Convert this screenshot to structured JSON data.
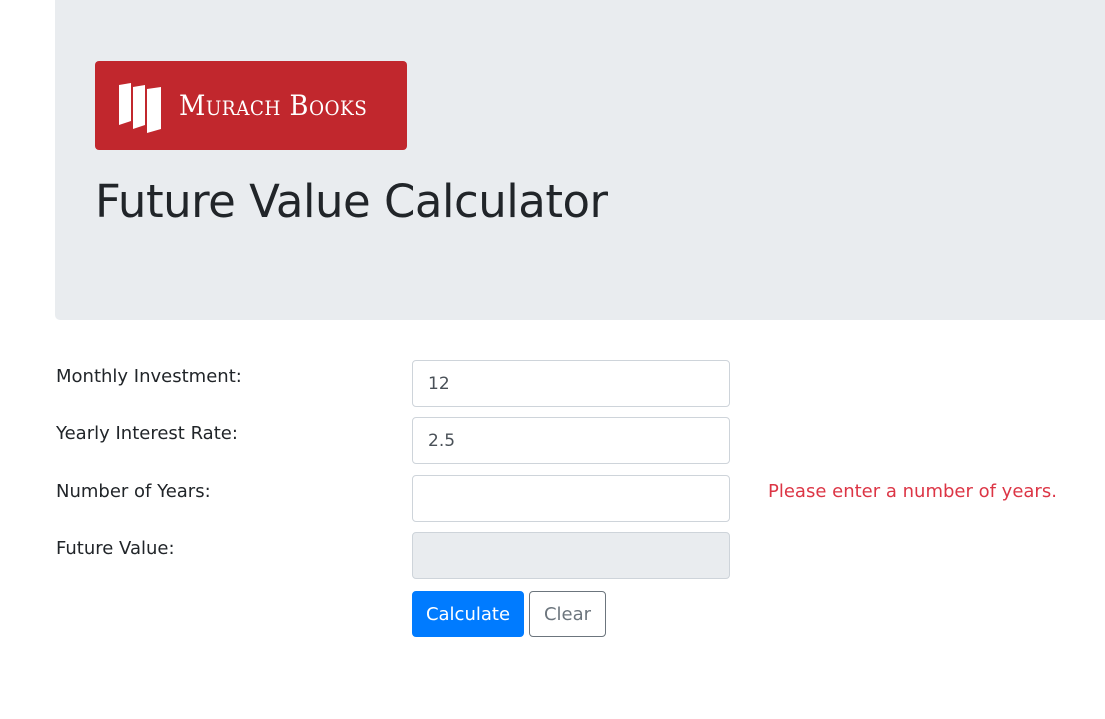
{
  "header": {
    "logo_text": "Murach Books",
    "title": "Future Value Calculator"
  },
  "form": {
    "investment": {
      "label": "Monthly Investment:",
      "value": "12"
    },
    "rate": {
      "label": "Yearly Interest Rate:",
      "value": "2.5"
    },
    "years": {
      "label": "Number of Years:",
      "value": "",
      "error": "Please enter a number of years."
    },
    "future_value": {
      "label": "Future Value:",
      "value": ""
    }
  },
  "buttons": {
    "calculate": "Calculate",
    "clear": "Clear"
  },
  "colors": {
    "brand_red": "#c1272d",
    "primary_blue": "#007bff",
    "error_red": "#dc3545"
  }
}
